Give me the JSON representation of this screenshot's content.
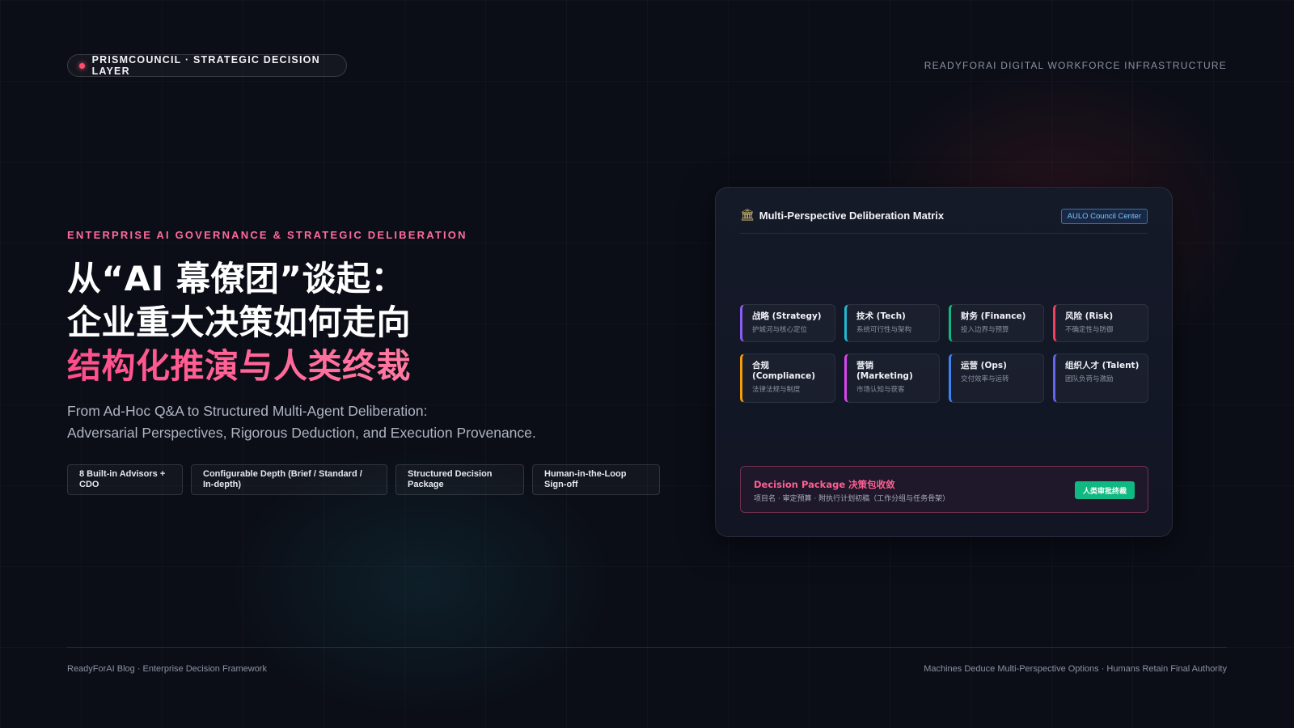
{
  "header": {
    "pill_label": "PRISMCOUNCIL · STRATEGIC DECISION LAYER",
    "right_label": "READYFORAI DIGITAL WORKFORCE INFRASTRUCTURE",
    "accent_color": "#ff4d6d"
  },
  "hero": {
    "eyebrow": "ENTERPRISE AI GOVERNANCE & STRATEGIC DELIBERATION",
    "title_lines": [
      "从“AI 幕僚团”谈起：",
      "企业重大决策如何走向",
      "结构化推演与人类终裁"
    ],
    "subtitle_lines": [
      "From Ad-Hoc Q&A to Structured Multi-Agent Deliberation:",
      "Adversarial Perspectives, Rigorous Deduction, and Execution Provenance."
    ],
    "chips": [
      "8 Built-in Advisors + CDO",
      "Configurable Depth (Brief / Standard / In-depth)",
      "Structured Decision Package",
      "Human-in-the-Loop Sign-off"
    ]
  },
  "panel": {
    "icon": "bank-icon",
    "title": "Multi-Perspective Deliberation Matrix",
    "badge": "AULO Council Center",
    "advisors": [
      {
        "title": "战略 (Strategy)",
        "desc": "护城河与核心定位",
        "color": "#8b5cf6"
      },
      {
        "title": "技术 (Tech)",
        "desc": "系统可行性与架构",
        "color": "#22b8cf"
      },
      {
        "title": "财务 (Finance)",
        "desc": "投入边界与预算",
        "color": "#10b981"
      },
      {
        "title": "风险 (Risk)",
        "desc": "不确定性与防御",
        "color": "#f43f5e"
      },
      {
        "title": "合规 (Compliance)",
        "desc": "法律法规与制度",
        "color": "#f59e0b"
      },
      {
        "title": "营销 (Marketing)",
        "desc": "市场认知与获客",
        "color": "#d946ef"
      },
      {
        "title": "运营 (Ops)",
        "desc": "交付效率与运转",
        "color": "#3b82f6"
      },
      {
        "title": "组织人才 (Talent)",
        "desc": "团队负荷与激励",
        "color": "#6366f1"
      }
    ],
    "decision": {
      "title": "Decision Package 决策包收敛",
      "desc": "项目名 · 审定预算 · 附执行计划初稿（工作分组与任务骨架）",
      "button": "人类审批终裁",
      "color": "#10b981"
    }
  },
  "footer": {
    "left": "ReadyForAI Blog · Enterprise Decision Framework",
    "right": "Machines Deduce Multi-Perspective Options · Humans Retain Final Authority"
  }
}
